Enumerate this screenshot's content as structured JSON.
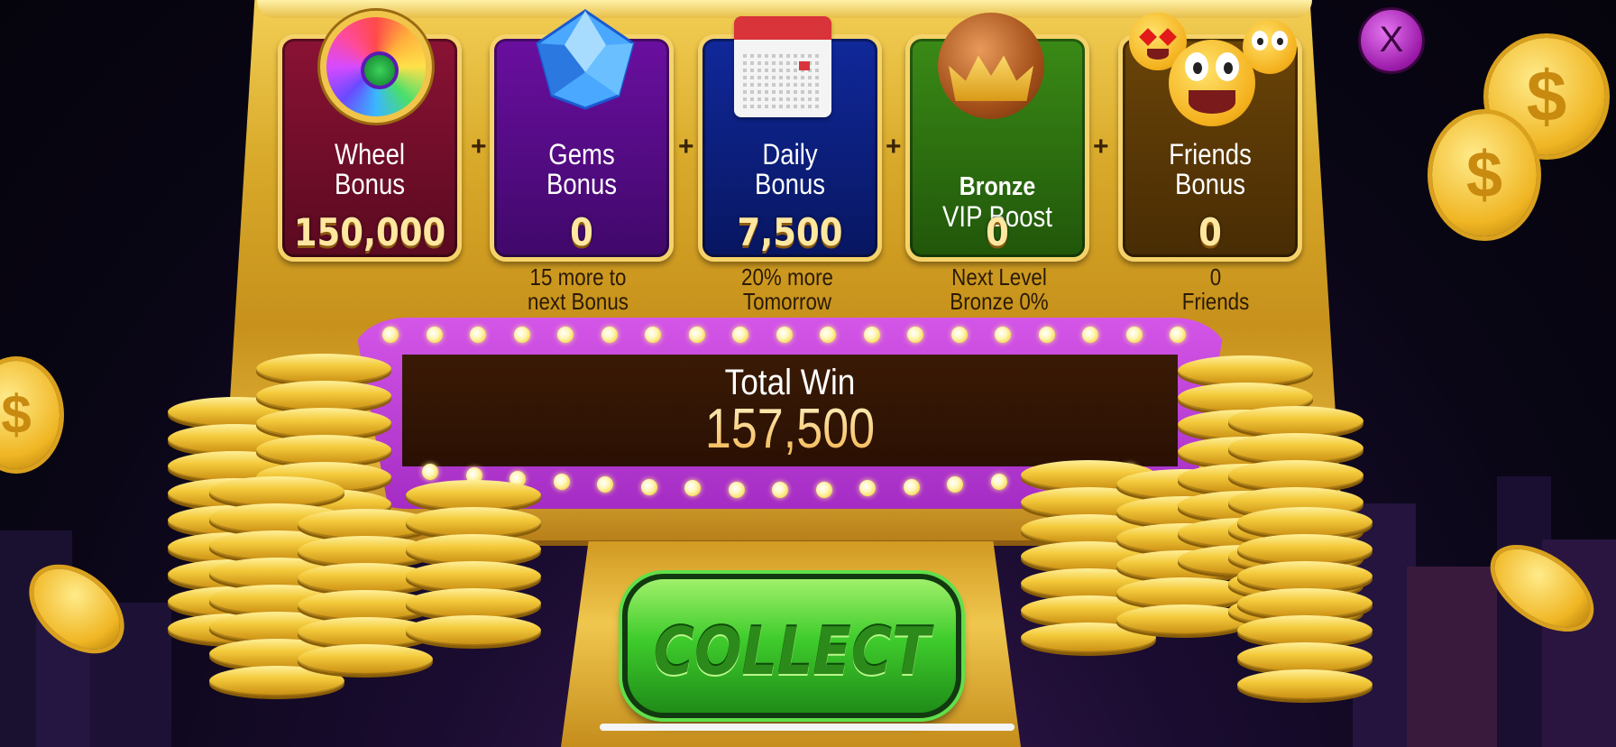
{
  "bonuses": [
    {
      "name_line1": "Wheel",
      "name_line2": "Bonus",
      "amount": "150,000",
      "color": "#6a0f2a",
      "icon": "prize-wheel-icon"
    },
    {
      "name_line1": "Gems",
      "name_line2": "Bonus",
      "amount": "0",
      "subtext_line1": "15 more to",
      "subtext_line2": "next Bonus",
      "color": "#4a0a78",
      "icon": "gem-icon"
    },
    {
      "name_line1": "Daily",
      "name_line2": "Bonus",
      "amount": "7,500",
      "subtext_line1": "20% more",
      "subtext_line2": "Tomorrow",
      "color": "#0c1f78",
      "icon": "calendar-icon"
    },
    {
      "name_line1": "Bronze",
      "name_line2": "VIP Boost",
      "amount": "0",
      "subtext_line1": "Next Level",
      "subtext_line2": "Bronze 0%",
      "color": "#2f6a10",
      "icon": "crown-icon"
    },
    {
      "name_line1": "Friends",
      "name_line2": "Bonus",
      "amount": "0",
      "subtext_line1": "0",
      "subtext_line2": "Friends",
      "color": "#5a3a05",
      "icon": "emoji-friends-icon"
    }
  ],
  "plus_sign": "+",
  "total": {
    "label": "Total Win",
    "value": "157,500"
  },
  "collect_label": "COLLECT",
  "close_label": "X",
  "coin_symbol": "$"
}
